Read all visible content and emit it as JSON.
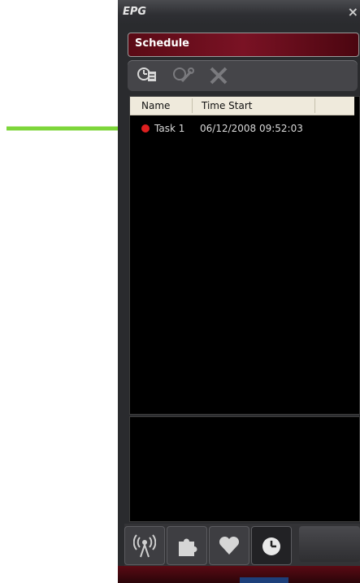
{
  "window": {
    "title": "EPG",
    "close_label": "×"
  },
  "panel": {
    "header": "Schedule"
  },
  "toolbar": {
    "buttons": [
      {
        "icon": "schedule-add-icon",
        "enabled": true
      },
      {
        "icon": "wrench-edit-icon",
        "enabled": false
      },
      {
        "icon": "close-delete-icon",
        "enabled": false
      }
    ]
  },
  "list": {
    "columns": [
      "Name",
      "Time Start"
    ],
    "rows": [
      {
        "name": "Task 1",
        "time_start": "06/12/2008 09:52:03",
        "status_color": "#dd1f1f"
      }
    ]
  },
  "tabs": [
    {
      "icon": "antenna-icon"
    },
    {
      "icon": "puzzle-icon"
    },
    {
      "icon": "heart-icon"
    },
    {
      "icon": "clock-icon",
      "active": true
    }
  ],
  "colors": {
    "accent": "#7a1224",
    "arrow": "#7dd63a"
  }
}
